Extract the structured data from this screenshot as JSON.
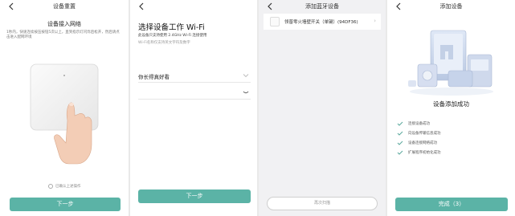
{
  "panel1": {
    "title": "设备重置",
    "subtitle": "设备接入网络",
    "description": "1秒内，快速连续按压按钮5次以上，直到指示灯闪烁后松开，然后请点击进入配网环境",
    "confirm_label": "已确认上述操作",
    "next_label": "下一步"
  },
  "panel2": {
    "heading": "选择设备工作 Wi-Fi",
    "line1": "此设备只支持使用 2.4GHz Wi-Fi 连接使用",
    "line2": "Wi-Fi名称仅支持英文字符及数字",
    "wifi_name": "你长得真好看",
    "password": "",
    "next_label": "下一步"
  },
  "panel3": {
    "title": "添加蓝牙设备",
    "device_name": "领普零火墙壁开关（单键）(94DF36)",
    "rescan_label": "再次扫描"
  },
  "panel4": {
    "title": "添加设备",
    "success_title": "设备添加成功",
    "steps": [
      {
        "label": "连接设备成功"
      },
      {
        "label": "向设备传输信息成功"
      },
      {
        "label": "设备连接网络成功"
      },
      {
        "label": "扩展程序初始化成功"
      }
    ],
    "done_label": "完成（3）"
  },
  "colors": {
    "accent": "#5bb3a6",
    "check": "#5aa99d"
  },
  "icons": {
    "back": "chevron-left-icon",
    "dropdown": "chevron-down-icon",
    "row_arrow": "chevron-right-icon",
    "check": "check-icon"
  }
}
